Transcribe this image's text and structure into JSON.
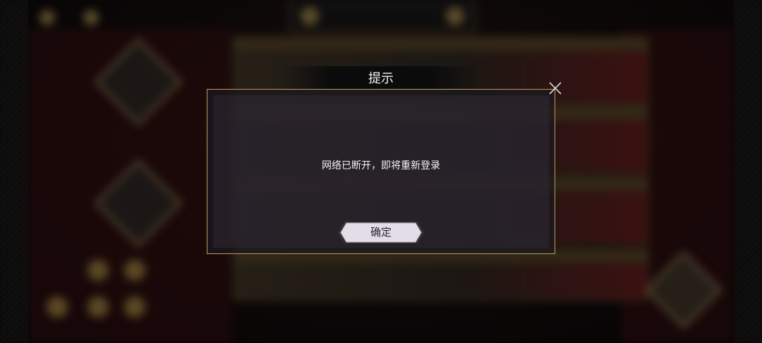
{
  "dialog": {
    "title": "提示",
    "message": "网络已断开，即将重新登录",
    "confirm_label": "确定"
  },
  "colors": {
    "dialog_border": "#b89a5e",
    "button_fill": "#e2dde6",
    "button_text": "#2e2a33"
  },
  "icons": {
    "close": "close-icon"
  }
}
